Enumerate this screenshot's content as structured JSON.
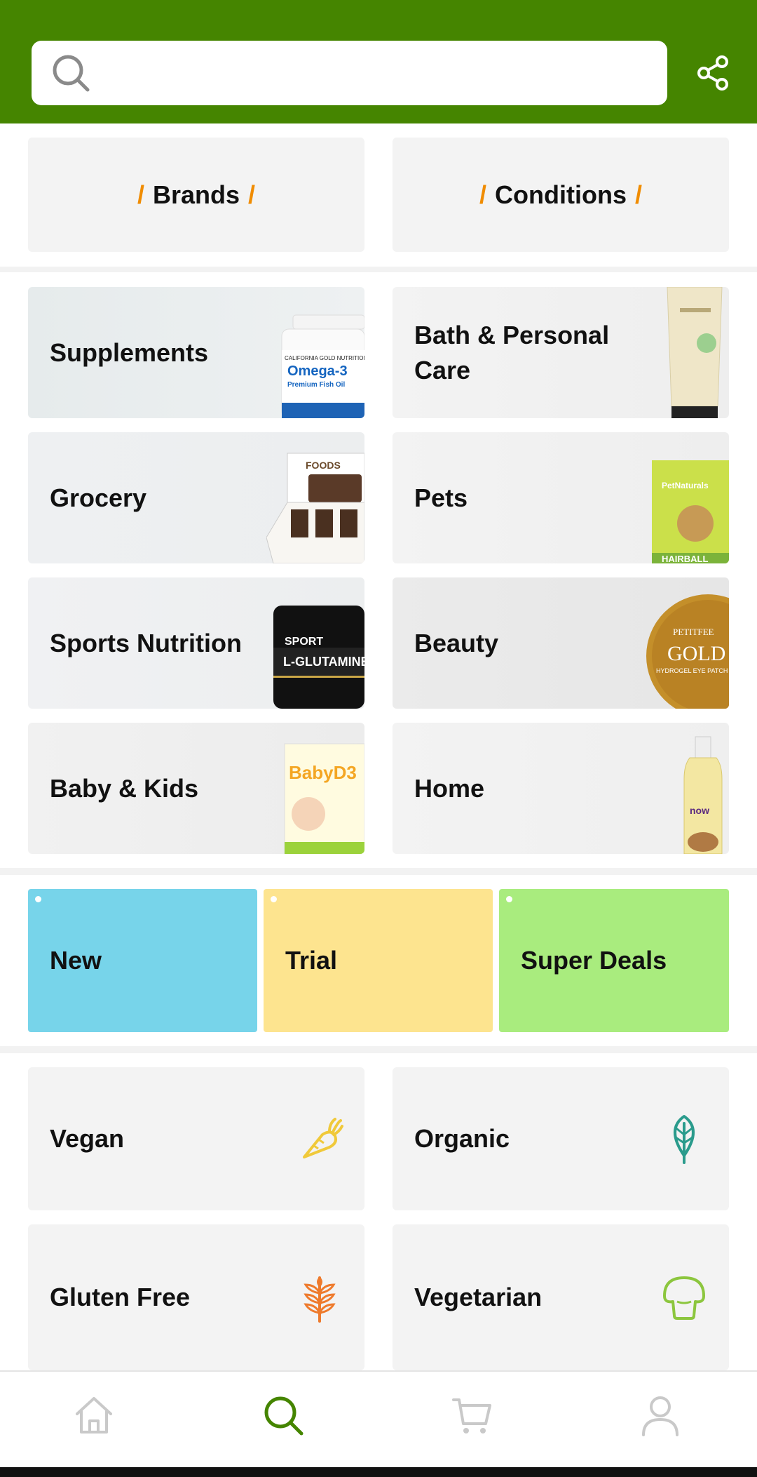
{
  "search": {
    "placeholder": "",
    "icon": "search-icon"
  },
  "header": {
    "share_icon": "share-icon"
  },
  "quick_nav": [
    {
      "label": "Brands"
    },
    {
      "label": "Conditions"
    }
  ],
  "categories": [
    {
      "label": "Supplements",
      "product": "Omega-3 Premium Fish Oil bottle"
    },
    {
      "label": "Bath & Personal Care",
      "product": "Hand cream tube"
    },
    {
      "label": "Grocery",
      "product": "Brownie bars box"
    },
    {
      "label": "Pets",
      "product": "PetNaturals hairball pack"
    },
    {
      "label": "Sports Nutrition",
      "product": "L-Glutamine jar"
    },
    {
      "label": "Beauty",
      "product": "Gold hydrogel eye patch"
    },
    {
      "label": "Baby & Kids",
      "product": "Baby D3 box"
    },
    {
      "label": "Home",
      "product": "Almond oil bottle"
    }
  ],
  "product_text": {
    "omega_brand": "CALIFORNIA GOLD NUTRITION",
    "omega_name": "Omega-3",
    "omega_sub": "Premium Fish Oil",
    "foods": "FOODS",
    "pet_brand": "PetNaturals",
    "pet_name": "HAIRBALL",
    "sport_top": "SPORT",
    "sport_name": "L-GLUTAMINE",
    "beauty_brand": "PETITFEE",
    "beauty_name": "GOLD",
    "beauty_sub": "HYDROGEL EYE PATCH",
    "baby_name": "BabyD3",
    "home_brand": "now"
  },
  "promos": [
    {
      "label": "New",
      "color": "#77d4ea"
    },
    {
      "label": "Trial",
      "color": "#fde48f"
    },
    {
      "label": "Super Deals",
      "color": "#a9ec7e"
    }
  ],
  "diets": [
    {
      "label": "Vegan",
      "icon": "carrot-icon",
      "color": "#f0c93a"
    },
    {
      "label": "Organic",
      "icon": "leaf-icon",
      "color": "#2a9b8c"
    },
    {
      "label": "Gluten Free",
      "icon": "wheat-icon",
      "color": "#ee7a2c"
    },
    {
      "label": "Vegetarian",
      "icon": "mushroom-icon",
      "color": "#8cc63e"
    }
  ],
  "bottom_nav": [
    {
      "name": "home-icon",
      "active": false
    },
    {
      "name": "search-icon",
      "active": true
    },
    {
      "name": "cart-icon",
      "active": false
    },
    {
      "name": "account-icon",
      "active": false
    }
  ],
  "colors": {
    "brand_green": "#458500",
    "accent_orange": "#f08c00"
  }
}
